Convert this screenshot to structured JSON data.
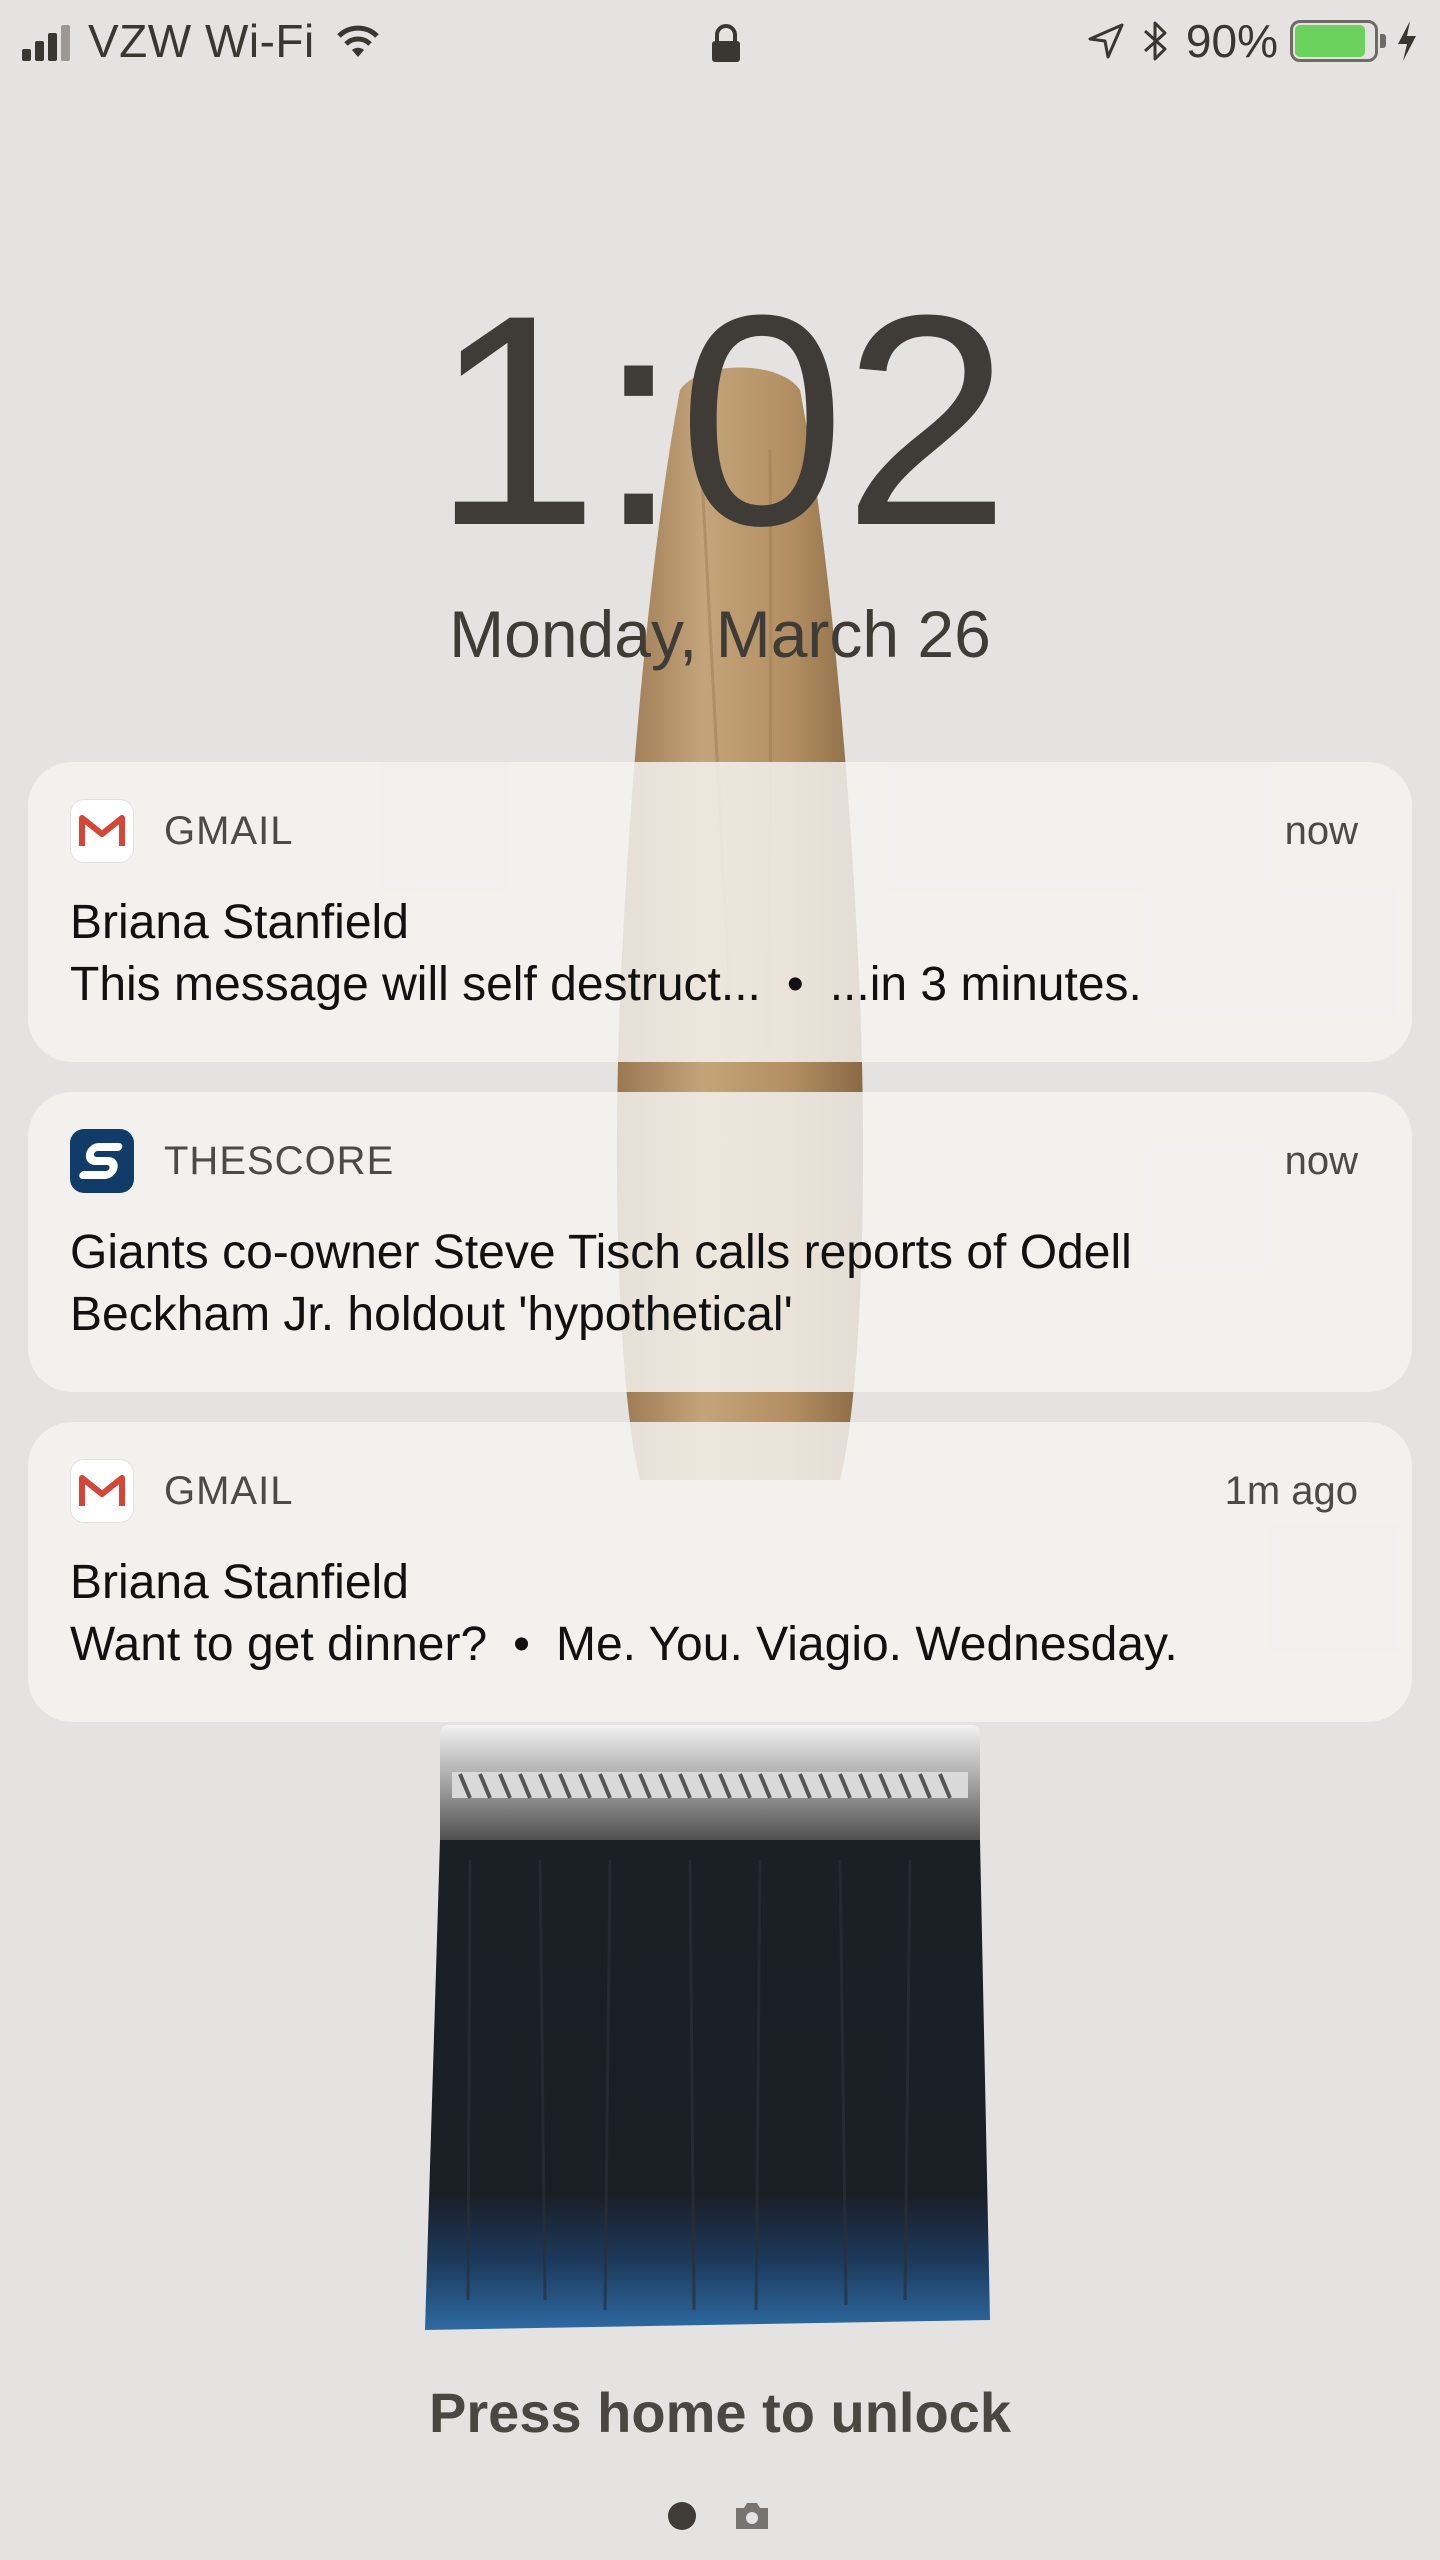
{
  "status_bar": {
    "carrier": "VZW Wi-Fi",
    "battery_percent": "90%",
    "battery_level": 0.9,
    "icons": [
      "signal-icon",
      "wifi-icon",
      "lock-icon",
      "location-icon",
      "bluetooth-icon",
      "battery-icon",
      "charging-icon"
    ]
  },
  "lock_screen": {
    "time": "1:02",
    "date": "Monday, March 26",
    "unlock_hint": "Press home to unlock"
  },
  "notifications": [
    {
      "app": "GMAIL",
      "icon": "gmail-icon",
      "time": "now",
      "line1": "Briana Stanfield",
      "line2_a": "This message will self destruct...",
      "line2_sep": "•",
      "line2_b": "...in 3 minutes."
    },
    {
      "app": "THESCORE",
      "icon": "thescore-icon",
      "time": "now",
      "line1": "Giants co-owner Steve Tisch calls reports of Odell",
      "line2": "Beckham Jr. holdout 'hypothetical'"
    },
    {
      "app": "GMAIL",
      "icon": "gmail-icon",
      "time": "1m ago",
      "line1": "Briana Stanfield",
      "line2_a": "Want to get dinner?",
      "line2_sep": "•",
      "line2_b": "Me. You. Viagio. Wednesday."
    }
  ],
  "pager": {
    "icons": [
      "page-dot-icon",
      "camera-icon"
    ]
  },
  "colors": {
    "background": "#e4e3e1",
    "clock_text": "#3f3b36",
    "battery_fill": "#6bd35d",
    "notification_bg": "#f4f3f1",
    "brush_wood": "#b8966b",
    "brush_bristles": "#1a1e24",
    "brush_blue": "#2f6aa0"
  }
}
